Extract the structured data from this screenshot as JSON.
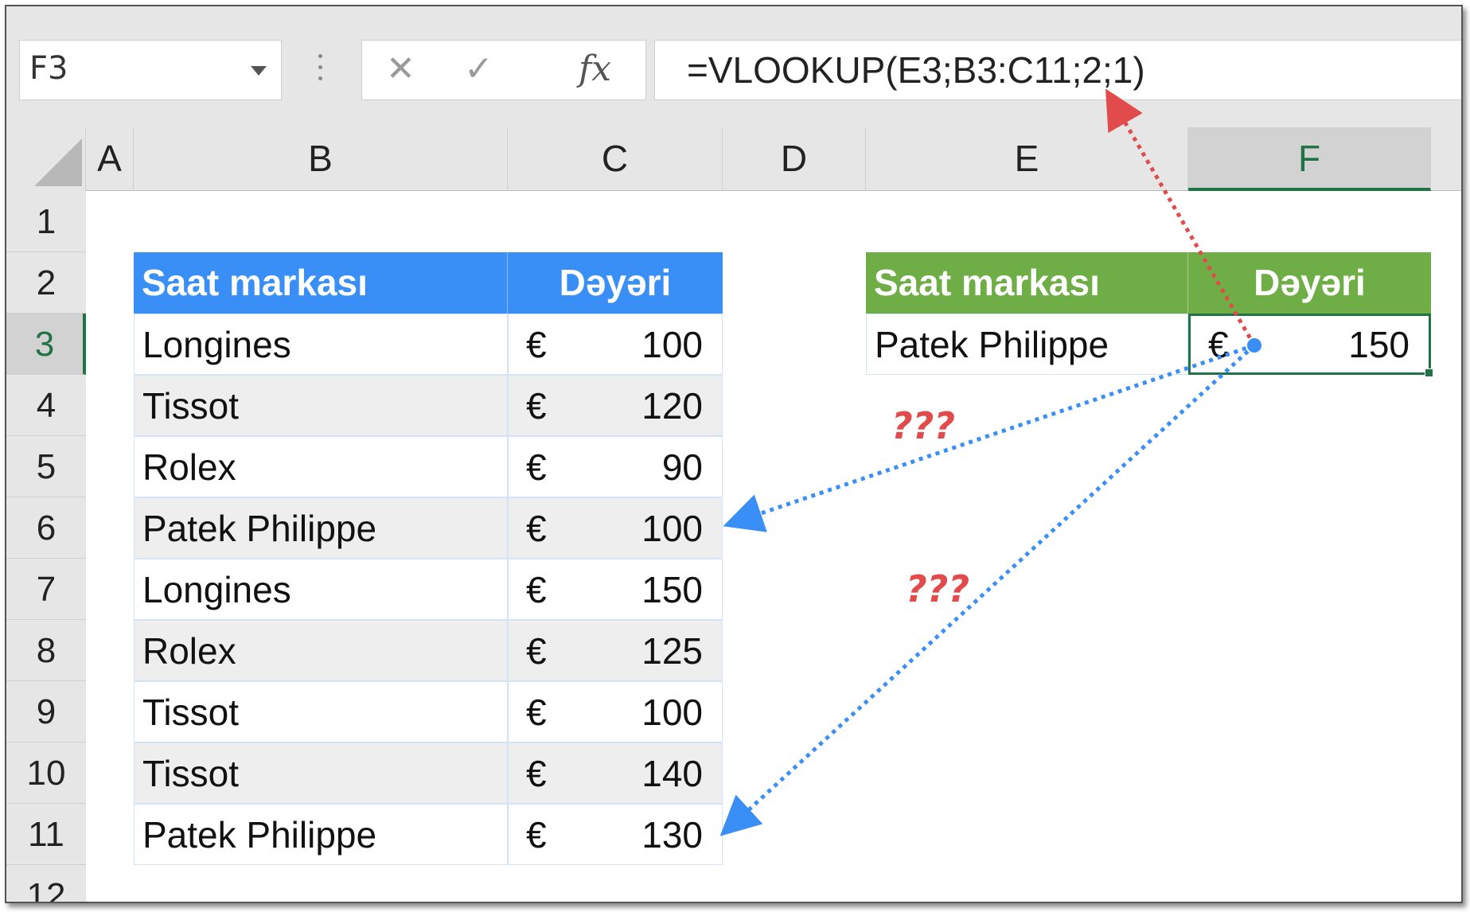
{
  "formula_bar": {
    "name_box": "F3",
    "cancel_icon": "close-icon",
    "enter_icon": "check-icon",
    "fx_label": "fx",
    "formula": "=VLOOKUP(E3;B3:C11;2;1)"
  },
  "columns": [
    "A",
    "B",
    "C",
    "D",
    "E",
    "F"
  ],
  "rows": [
    "1",
    "2",
    "3",
    "4",
    "5",
    "6",
    "7",
    "8",
    "9",
    "10",
    "11",
    "12"
  ],
  "selected": {
    "column": "F",
    "row": "3"
  },
  "left_table": {
    "header": {
      "name": "Saat markası",
      "value": "Dəyəri"
    },
    "currency": "€",
    "rows": [
      {
        "name": "Longines",
        "value": "100"
      },
      {
        "name": "Tissot",
        "value": "120"
      },
      {
        "name": "Rolex",
        "value": "90"
      },
      {
        "name": "Patek Philippe",
        "value": "100"
      },
      {
        "name": "Longines",
        "value": "150"
      },
      {
        "name": "Rolex",
        "value": "125"
      },
      {
        "name": "Tissot",
        "value": "100"
      },
      {
        "name": "Tissot",
        "value": "140"
      },
      {
        "name": "Patek Philippe",
        "value": "130"
      }
    ]
  },
  "right_table": {
    "header": {
      "name": "Saat markası",
      "value": "Dəyəri"
    },
    "currency": "€",
    "lookup": {
      "name": "Patek Philippe",
      "value": "150"
    }
  },
  "annotations": {
    "question_1": "???",
    "question_2": "???"
  },
  "colors": {
    "blue_header": "#3a8ff7",
    "green_header": "#6fad46",
    "selection": "#217346",
    "arrow_red": "#e24b4b",
    "arrow_blue": "#3a8ff7"
  }
}
